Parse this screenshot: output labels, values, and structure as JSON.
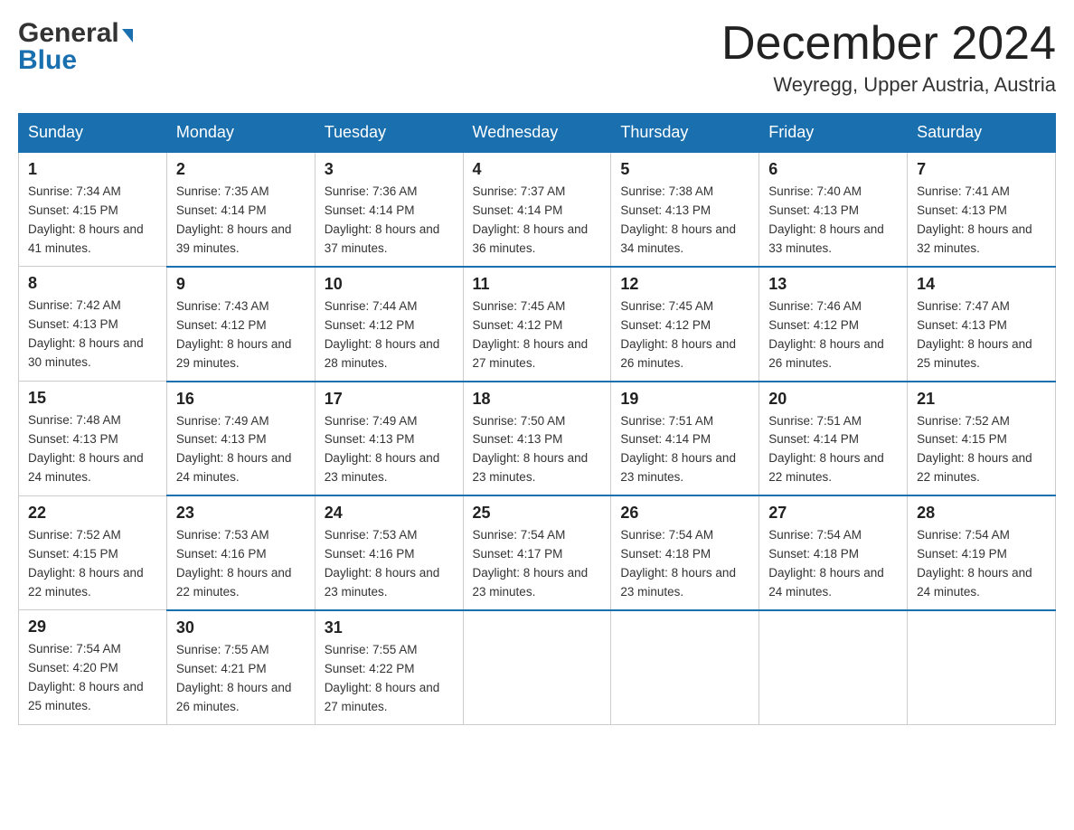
{
  "header": {
    "logo_line1": "General",
    "logo_line2": "Blue",
    "month_title": "December 2024",
    "location": "Weyregg, Upper Austria, Austria"
  },
  "days_of_week": [
    "Sunday",
    "Monday",
    "Tuesday",
    "Wednesday",
    "Thursday",
    "Friday",
    "Saturday"
  ],
  "weeks": [
    [
      {
        "day": "1",
        "sunrise": "7:34 AM",
        "sunset": "4:15 PM",
        "daylight": "8 hours and 41 minutes."
      },
      {
        "day": "2",
        "sunrise": "7:35 AM",
        "sunset": "4:14 PM",
        "daylight": "8 hours and 39 minutes."
      },
      {
        "day": "3",
        "sunrise": "7:36 AM",
        "sunset": "4:14 PM",
        "daylight": "8 hours and 37 minutes."
      },
      {
        "day": "4",
        "sunrise": "7:37 AM",
        "sunset": "4:14 PM",
        "daylight": "8 hours and 36 minutes."
      },
      {
        "day": "5",
        "sunrise": "7:38 AM",
        "sunset": "4:13 PM",
        "daylight": "8 hours and 34 minutes."
      },
      {
        "day": "6",
        "sunrise": "7:40 AM",
        "sunset": "4:13 PM",
        "daylight": "8 hours and 33 minutes."
      },
      {
        "day": "7",
        "sunrise": "7:41 AM",
        "sunset": "4:13 PM",
        "daylight": "8 hours and 32 minutes."
      }
    ],
    [
      {
        "day": "8",
        "sunrise": "7:42 AM",
        "sunset": "4:13 PM",
        "daylight": "8 hours and 30 minutes."
      },
      {
        "day": "9",
        "sunrise": "7:43 AM",
        "sunset": "4:12 PM",
        "daylight": "8 hours and 29 minutes."
      },
      {
        "day": "10",
        "sunrise": "7:44 AM",
        "sunset": "4:12 PM",
        "daylight": "8 hours and 28 minutes."
      },
      {
        "day": "11",
        "sunrise": "7:45 AM",
        "sunset": "4:12 PM",
        "daylight": "8 hours and 27 minutes."
      },
      {
        "day": "12",
        "sunrise": "7:45 AM",
        "sunset": "4:12 PM",
        "daylight": "8 hours and 26 minutes."
      },
      {
        "day": "13",
        "sunrise": "7:46 AM",
        "sunset": "4:12 PM",
        "daylight": "8 hours and 26 minutes."
      },
      {
        "day": "14",
        "sunrise": "7:47 AM",
        "sunset": "4:13 PM",
        "daylight": "8 hours and 25 minutes."
      }
    ],
    [
      {
        "day": "15",
        "sunrise": "7:48 AM",
        "sunset": "4:13 PM",
        "daylight": "8 hours and 24 minutes."
      },
      {
        "day": "16",
        "sunrise": "7:49 AM",
        "sunset": "4:13 PM",
        "daylight": "8 hours and 24 minutes."
      },
      {
        "day": "17",
        "sunrise": "7:49 AM",
        "sunset": "4:13 PM",
        "daylight": "8 hours and 23 minutes."
      },
      {
        "day": "18",
        "sunrise": "7:50 AM",
        "sunset": "4:13 PM",
        "daylight": "8 hours and 23 minutes."
      },
      {
        "day": "19",
        "sunrise": "7:51 AM",
        "sunset": "4:14 PM",
        "daylight": "8 hours and 23 minutes."
      },
      {
        "day": "20",
        "sunrise": "7:51 AM",
        "sunset": "4:14 PM",
        "daylight": "8 hours and 22 minutes."
      },
      {
        "day": "21",
        "sunrise": "7:52 AM",
        "sunset": "4:15 PM",
        "daylight": "8 hours and 22 minutes."
      }
    ],
    [
      {
        "day": "22",
        "sunrise": "7:52 AM",
        "sunset": "4:15 PM",
        "daylight": "8 hours and 22 minutes."
      },
      {
        "day": "23",
        "sunrise": "7:53 AM",
        "sunset": "4:16 PM",
        "daylight": "8 hours and 22 minutes."
      },
      {
        "day": "24",
        "sunrise": "7:53 AM",
        "sunset": "4:16 PM",
        "daylight": "8 hours and 23 minutes."
      },
      {
        "day": "25",
        "sunrise": "7:54 AM",
        "sunset": "4:17 PM",
        "daylight": "8 hours and 23 minutes."
      },
      {
        "day": "26",
        "sunrise": "7:54 AM",
        "sunset": "4:18 PM",
        "daylight": "8 hours and 23 minutes."
      },
      {
        "day": "27",
        "sunrise": "7:54 AM",
        "sunset": "4:18 PM",
        "daylight": "8 hours and 24 minutes."
      },
      {
        "day": "28",
        "sunrise": "7:54 AM",
        "sunset": "4:19 PM",
        "daylight": "8 hours and 24 minutes."
      }
    ],
    [
      {
        "day": "29",
        "sunrise": "7:54 AM",
        "sunset": "4:20 PM",
        "daylight": "8 hours and 25 minutes."
      },
      {
        "day": "30",
        "sunrise": "7:55 AM",
        "sunset": "4:21 PM",
        "daylight": "8 hours and 26 minutes."
      },
      {
        "day": "31",
        "sunrise": "7:55 AM",
        "sunset": "4:22 PM",
        "daylight": "8 hours and 27 minutes."
      },
      null,
      null,
      null,
      null
    ]
  ]
}
